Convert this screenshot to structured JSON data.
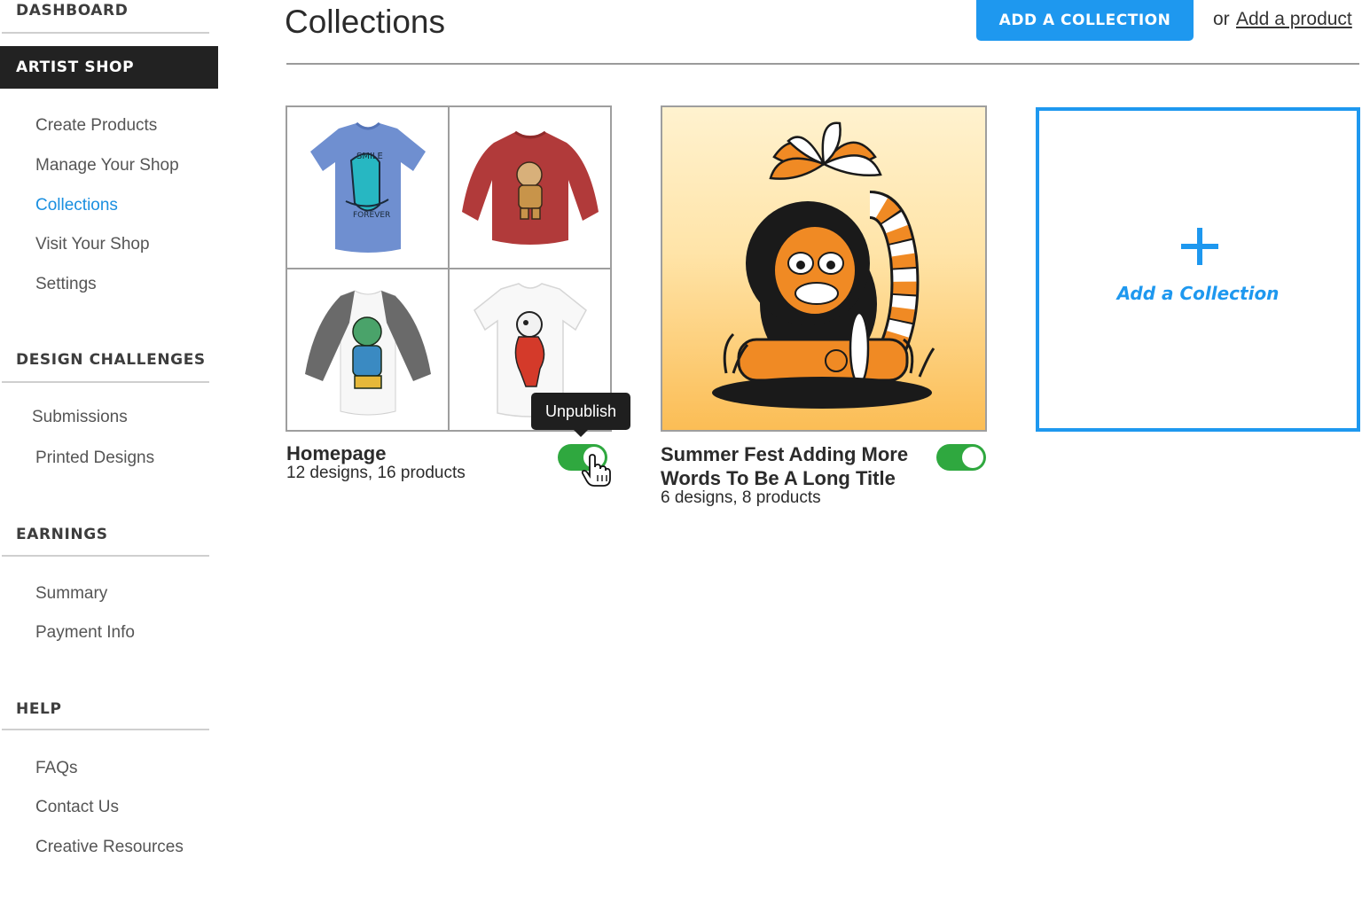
{
  "sidebar": {
    "dashboard": "DASHBOARD",
    "artist_shop": "ARTIST SHOP",
    "artist_items": [
      "Create Products",
      "Manage Your Shop",
      "Collections",
      "Visit Your Shop",
      "Settings"
    ],
    "design_challenges": "DESIGN CHALLENGES",
    "challenge_items": [
      "Submissions",
      "Printed Designs"
    ],
    "earnings": "EARNINGS",
    "earning_items": [
      "Summary",
      "Payment Info"
    ],
    "help": "HELP",
    "help_items": [
      "FAQs",
      "Contact Us",
      "Creative Resources"
    ],
    "active_item": "Collections"
  },
  "header": {
    "title": "Collections",
    "add_collection_button": "ADD A COLLECTION",
    "or_text": "or",
    "add_product_link": "Add a product"
  },
  "collections": [
    {
      "title": "Homepage",
      "subtitle": "12 designs, 16 products",
      "published": true,
      "thumbnails": [
        "blue-tshirt",
        "red-sweatshirt",
        "raglan-tshirt",
        "white-tshirt"
      ]
    },
    {
      "title": "Summer Fest Adding More Words To Be A Long Title",
      "title_lines": [
        "Summer Fest Adding More",
        "Words To Be A Long Title"
      ],
      "subtitle": "6 designs, 8 products",
      "published": true
    }
  ],
  "tooltip": "Unpublish",
  "add_card": {
    "label": "Add a Collection"
  },
  "colors": {
    "accent": "#1e98ef",
    "toggle_on": "#2fa83f",
    "active_nav_bg": "#222222"
  }
}
